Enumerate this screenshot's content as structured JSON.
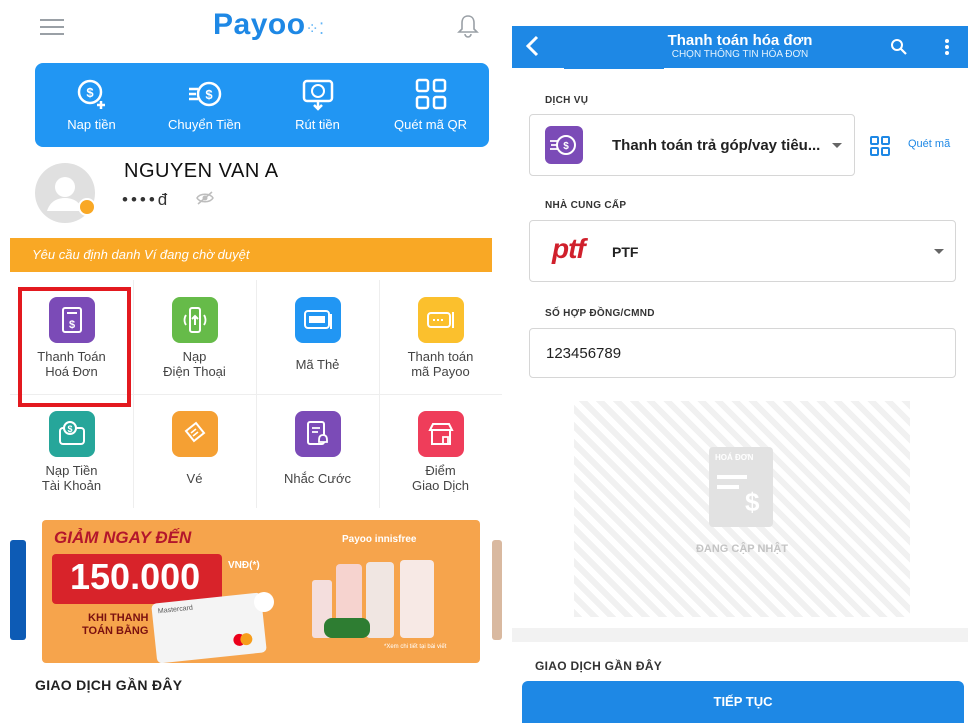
{
  "left": {
    "logo_text": "Payoo",
    "quick_actions": [
      {
        "label": "Nap tiền",
        "icon": "deposit-icon"
      },
      {
        "label": "Chuyển Tiền",
        "icon": "transfer-icon"
      },
      {
        "label": "Rút tiền",
        "icon": "withdraw-icon"
      },
      {
        "label": "Quét mã QR",
        "icon": "qr-scan-icon"
      }
    ],
    "profile": {
      "name": "NGUYEN VAN A",
      "balance_masked": "••••đ"
    },
    "verify_banner": "Yêu cầu định danh Ví đang chờ duyệt",
    "services": [
      {
        "label_1": "Thanh Toán",
        "label_2": "Hoá Đơn",
        "icon": "bill-icon",
        "color": "#7b4bb7"
      },
      {
        "label_1": "Nạp",
        "label_2": "Điện Thoại",
        "icon": "phone-topup-icon",
        "color": "#66bb49"
      },
      {
        "label_1": "Mã Thẻ",
        "label_2": "",
        "icon": "card-code-icon",
        "color": "#2196f3"
      },
      {
        "label_1": "Thanh toán",
        "label_2": "mã Payoo",
        "icon": "payoo-code-icon",
        "color": "#fbc02d"
      },
      {
        "label_1": "Nạp Tiền",
        "label_2": "Tài Khoản",
        "icon": "wallet-topup-icon",
        "color": "#26a69a"
      },
      {
        "label_1": "Vé",
        "label_2": "",
        "icon": "ticket-icon",
        "color": "#f5a033"
      },
      {
        "label_1": "Nhắc Cước",
        "label_2": "",
        "icon": "bill-reminder-icon",
        "color": "#7b4bb7"
      },
      {
        "label_1": "Điểm",
        "label_2": "Giao Dịch",
        "icon": "store-icon",
        "color": "#ef3d5a"
      }
    ],
    "promo": {
      "line1": "GIẢM NGAY ĐẾN",
      "amount": "150.000",
      "currency": "VNĐ(*)",
      "line3": "KHI THANH",
      "line4": "TOÁN BẰNG",
      "brands": "Payoo innisfree",
      "card_brand": "Mastercard",
      "footnote": "*Xem chi tiết tại bài viết"
    },
    "recent_title": "GIAO DỊCH GẦN ĐÂY"
  },
  "right": {
    "title": "Thanh toán hóa đơn",
    "subtitle": "CHỌN THÔNG TIN HÓA ĐƠN",
    "service_label": "DỊCH VỤ",
    "service_value": "Thanh toán trả góp/vay tiêu...",
    "scan_label": "Quét mã",
    "provider_label": "NHÀ CUNG CẤP",
    "provider_logo": "ptf",
    "provider_value": "PTF",
    "contract_label": "SỐ HỢP ĐỒNG/CMND",
    "contract_value": "123456789",
    "invoice_placeholder_title": "HOÁ ĐƠN",
    "invoice_placeholder_status": "ĐANG CẬP NHẬT",
    "recent_title": "GIAO DỊCH GẦN ĐÂY",
    "continue_label": "TIẾP TỤC"
  }
}
